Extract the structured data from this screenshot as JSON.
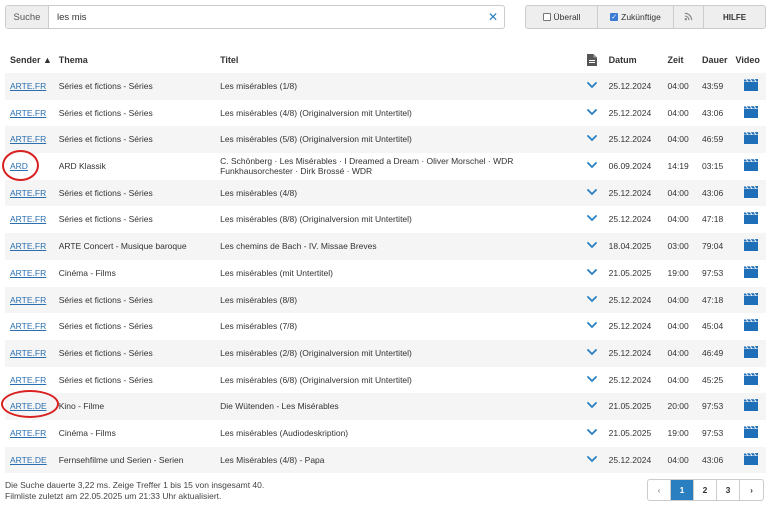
{
  "search": {
    "label": "Suche",
    "value": "les mis",
    "clear_symbol": "✕"
  },
  "toggles": {
    "ueberall_label": "Überall",
    "ueberall_checked": false,
    "zukuenftige_label": "Zukünftige",
    "zukuenftige_checked": true,
    "rss_icon": "rss-icon",
    "hilfe_label": "HILFE"
  },
  "columns": {
    "sender": "Sender ▲",
    "thema": "Thema",
    "titel": "Titel",
    "description_icon": "document-icon",
    "datum": "Datum",
    "zeit": "Zeit",
    "dauer": "Dauer",
    "video": "Video"
  },
  "rows": [
    {
      "sender": "ARTE.FR",
      "thema": "Séries et fictions - Séries",
      "titel": "Les misérables (1/8)",
      "datum": "25.12.2024",
      "zeit": "04:00",
      "dauer": "43:59"
    },
    {
      "sender": "ARTE.FR",
      "thema": "Séries et fictions - Séries",
      "titel": "Les misérables (4/8) (Originalversion mit Untertitel)",
      "datum": "25.12.2024",
      "zeit": "04:00",
      "dauer": "43:06"
    },
    {
      "sender": "ARTE.FR",
      "thema": "Séries et fictions - Séries",
      "titel": "Les misérables (5/8) (Originalversion mit Untertitel)",
      "datum": "25.12.2024",
      "zeit": "04:00",
      "dauer": "46:59"
    },
    {
      "sender": "ARD",
      "thema": "ARD Klassik",
      "titel": "C. Schönberg · Les Misérables · I Dreamed a Dream · Oliver Morschel · WDR Funkhausorchester · Dirk Brossé · WDR",
      "datum": "06.09.2024",
      "zeit": "14:19",
      "dauer": "03:15"
    },
    {
      "sender": "ARTE.FR",
      "thema": "Séries et fictions - Séries",
      "titel": "Les misérables (4/8)",
      "datum": "25.12.2024",
      "zeit": "04:00",
      "dauer": "43:06"
    },
    {
      "sender": "ARTE.FR",
      "thema": "Séries et fictions - Séries",
      "titel": "Les misérables (8/8) (Originalversion mit Untertitel)",
      "datum": "25.12.2024",
      "zeit": "04:00",
      "dauer": "47:18"
    },
    {
      "sender": "ARTE.FR",
      "thema": "ARTE Concert - Musique baroque",
      "titel": "Les chemins de Bach - IV. Missae Breves",
      "datum": "18.04.2025",
      "zeit": "03:00",
      "dauer": "79:04"
    },
    {
      "sender": "ARTE.FR",
      "thema": "Cinéma - Films",
      "titel": "Les misérables (mit Untertitel)",
      "datum": "21.05.2025",
      "zeit": "19:00",
      "dauer": "97:53"
    },
    {
      "sender": "ARTE.FR",
      "thema": "Séries et fictions - Séries",
      "titel": "Les misérables (8/8)",
      "datum": "25.12.2024",
      "zeit": "04:00",
      "dauer": "47:18"
    },
    {
      "sender": "ARTE.FR",
      "thema": "Séries et fictions - Séries",
      "titel": "Les misérables (7/8)",
      "datum": "25.12.2024",
      "zeit": "04:00",
      "dauer": "45:04"
    },
    {
      "sender": "ARTE.FR",
      "thema": "Séries et fictions - Séries",
      "titel": "Les misérables (2/8) (Originalversion mit Untertitel)",
      "datum": "25.12.2024",
      "zeit": "04:00",
      "dauer": "46:49"
    },
    {
      "sender": "ARTE.FR",
      "thema": "Séries et fictions - Séries",
      "titel": "Les misérables (6/8) (Originalversion mit Untertitel)",
      "datum": "25.12.2024",
      "zeit": "04:00",
      "dauer": "45:25"
    },
    {
      "sender": "ARTE.DE",
      "thema": "Kino - Filme",
      "titel": "Die Wütenden - Les Misérables",
      "datum": "21.05.2025",
      "zeit": "20:00",
      "dauer": "97:53"
    },
    {
      "sender": "ARTE.FR",
      "thema": "Cinéma - Films",
      "titel": "Les misérables (Audiodeskription)",
      "datum": "21.05.2025",
      "zeit": "19:00",
      "dauer": "97:53"
    },
    {
      "sender": "ARTE.DE",
      "thema": "Fernsehfilme und Serien - Serien",
      "titel": "Les Misérables (4/8) - Papa",
      "datum": "25.12.2024",
      "zeit": "04:00",
      "dauer": "43:06"
    }
  ],
  "footer": {
    "line1": "Die Suche dauerte 3,22 ms. Zeige Treffer 1 bis 15 von insgesamt 40.",
    "line2": "Filmliste zuletzt am 22.05.2025 um 21:33 Uhr aktualisiert."
  },
  "pagination": {
    "prev": "‹",
    "pages": [
      "1",
      "2",
      "3"
    ],
    "current": "1",
    "next": "›"
  },
  "colors": {
    "link": "#2a6fb0",
    "accent": "#2a7fc0",
    "annotation": "#d92020",
    "row_alt": "#f5f5f5"
  }
}
